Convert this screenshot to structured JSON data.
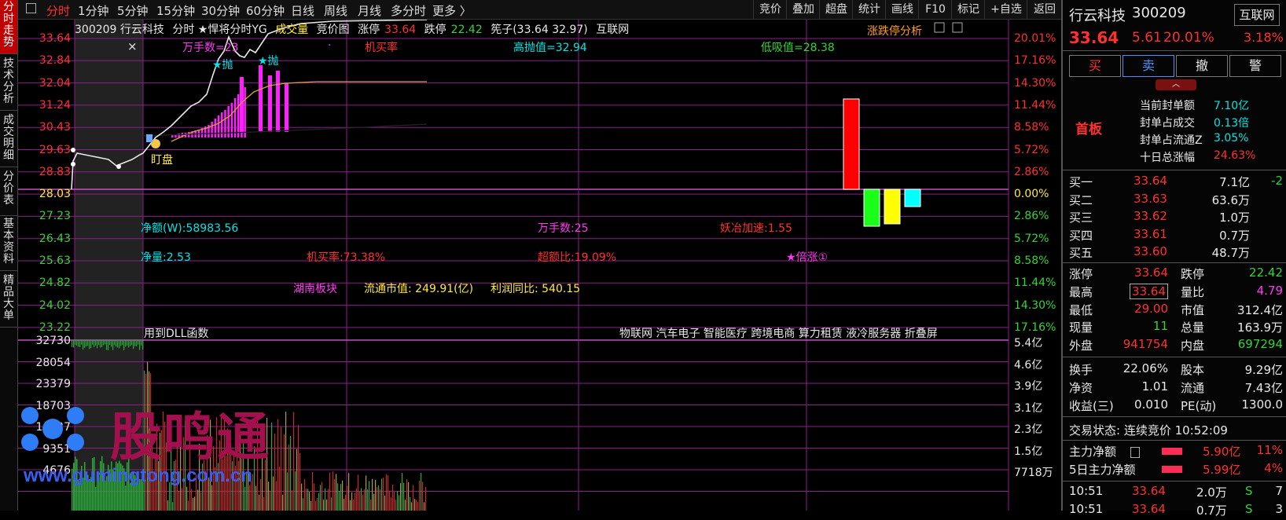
{
  "vtabs": [
    "分时走势",
    "技术分析",
    "成交明细",
    "分价表",
    "基本资料",
    "精品大单"
  ],
  "periods": [
    "分时",
    "1分钟",
    "5分钟",
    "15分钟",
    "30分钟",
    "60分钟",
    "日线",
    "周线",
    "月线",
    "多分时",
    "更多 〉"
  ],
  "toolbar": [
    "竞价",
    "叠加",
    "超盘",
    "统计",
    "画线",
    "F10",
    "标记",
    "+自选",
    "返回"
  ],
  "header": {
    "code_name": "300209 行云科技",
    "mode": "分时 ★悍将分时YG",
    "volume": "成交量",
    "auction": "竞价图",
    "limit_up_label": "涨停",
    "limit_up": "33.64",
    "limit_down_label": "跌停",
    "limit_down": "22.42",
    "chips": "筅子(33.64 32.97)",
    "concept": "互联网",
    "analysis": "涨跌停分析",
    "close_x": "×"
  },
  "price_axis": [
    "33.64",
    "32.84",
    "32.04",
    "31.24",
    "30.43",
    "29.63",
    "28.83",
    "28.03",
    "27.23",
    "26.43",
    "25.63",
    "24.82",
    "24.02",
    "23.22"
  ],
  "pct_axis": [
    "20.01%",
    "17.16%",
    "14.30%",
    "11.44%",
    "8.58%",
    "5.72%",
    "2.86%",
    "0.00%",
    "2.86%",
    "5.72%",
    "8.58%",
    "11.44%",
    "14.30%",
    "17.16%"
  ],
  "vol_axis_left": [
    "32730",
    "28054",
    "23379",
    "18703",
    "14027",
    "9351",
    "4676"
  ],
  "vol_axis_right": [
    "5.4亿",
    "4.6亿",
    "3.9亿",
    "3.1亿",
    "2.3亿",
    "1.5亿",
    "7718万"
  ],
  "annotations": {
    "wanshou_top": "万手数=23",
    "jimai_top": "机买率",
    "high_throw": "高抛值=32.94",
    "low_buy": "低吸值=28.38",
    "throw1": "★抛",
    "throw2": "★抛",
    "pan": "盯盘",
    "net_amount": "净额(W):58983.56",
    "wanshou": "万手数:25",
    "yaozhi": "妖冶加速:1.55",
    "net_qty": "净量:2.53",
    "jimai": "机买率:73.38%",
    "chaoe": "超额比:19.09%",
    "beizhang": "★倍涨①",
    "sector": "湖南板块",
    "float_cap": "流通市值:  249.91(亿)",
    "profit_yoy": "利润同比:  540.15",
    "dll": "用到DLL函数",
    "concepts": "物联网  汽车电子  智能医疗  跨境电商  算力租赁  液冷服务器  折叠屏"
  },
  "watermark": {
    "brand": "股鸣通",
    "url": "www.gumingtong.com.cn"
  },
  "stock": {
    "name": "行云科技",
    "code": "300209",
    "tag": "互联网",
    "price": "33.64",
    "change": "5.61",
    "pct": "20.01%",
    "tag_pct": "3.18%",
    "trade_buttons": [
      "买",
      "卖",
      "撤",
      "警"
    ],
    "board": "首板",
    "seal": [
      {
        "label": "当前封单额",
        "value": "7.10亿"
      },
      {
        "label": "封单占成交",
        "value": "0.13倍"
      },
      {
        "label": "封单占流通Z",
        "value": "3.05%"
      },
      {
        "label": "十日总涨幅",
        "value": "24.63%"
      }
    ],
    "bids": [
      {
        "label": "买一",
        "price": "33.64",
        "vol": "7.1亿",
        "chg": "-2"
      },
      {
        "label": "买二",
        "price": "33.63",
        "vol": "63.6万",
        "chg": ""
      },
      {
        "label": "买三",
        "price": "33.62",
        "vol": "1.0万",
        "chg": ""
      },
      {
        "label": "买四",
        "price": "33.61",
        "vol": "0.7万",
        "chg": ""
      },
      {
        "label": "买五",
        "price": "33.60",
        "vol": "48.7万",
        "chg": ""
      }
    ],
    "stats": [
      [
        "涨停",
        "33.64",
        "跌停",
        "22.42"
      ],
      [
        "最高",
        "33.64",
        "量比",
        "4.79"
      ],
      [
        "最低",
        "29.00",
        "市值",
        "312.4亿"
      ],
      [
        "现量",
        "11",
        "总量",
        "163.9万"
      ],
      [
        "外盘",
        "941754",
        "内盘",
        "697294"
      ]
    ],
    "stats2": [
      [
        "换手",
        "22.06%",
        "股本",
        "9.29亿"
      ],
      [
        "净资",
        "1.01",
        "流通",
        "7.43亿"
      ],
      [
        "收益(三)",
        "0.010",
        "PE(动)",
        "1300.0"
      ]
    ],
    "trade_status": "交易状态: 连续竞价 10:52:09",
    "fund": [
      {
        "label": "主力净额",
        "value": "5.90亿",
        "pct": "11%"
      },
      {
        "label": "5日主力净额",
        "value": "5.99亿",
        "pct": "4%"
      }
    ],
    "ticks": [
      {
        "time": "10:51",
        "price": "33.64",
        "vol": "2.0万",
        "dir": "S",
        "n": "7"
      },
      {
        "time": "10:51",
        "price": "33.64",
        "vol": "0.7万",
        "dir": "S",
        "n": "3"
      }
    ]
  },
  "colors": {
    "up": "#ff3030",
    "down": "#35d435",
    "grid": "#8b1f8b",
    "accent": "#c00000"
  }
}
